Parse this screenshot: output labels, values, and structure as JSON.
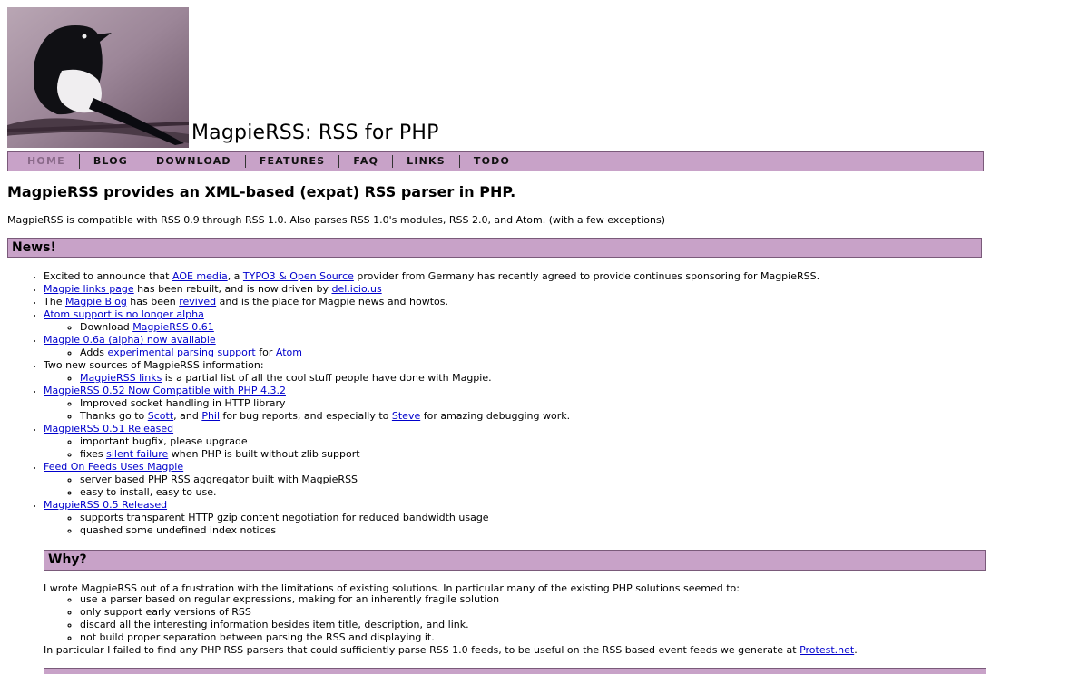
{
  "site": {
    "title": "MagpieRSS: RSS for PHP"
  },
  "nav": [
    {
      "label": "HOME"
    },
    {
      "label": "BLOG"
    },
    {
      "label": "DOWNLOAD"
    },
    {
      "label": "FEATURES"
    },
    {
      "label": "FAQ"
    },
    {
      "label": "LINKS"
    },
    {
      "label": "TODO"
    }
  ],
  "tagline": "MagpieRSS provides an XML-based (expat) RSS parser in PHP.",
  "intro": "MagpieRSS is compatible with RSS 0.9 through RSS 1.0. Also parses RSS 1.0's modules, RSS 2.0, and Atom. (with a few exceptions)",
  "news": {
    "heading": "News!",
    "items": {
      "i0": {
        "t1": "Excited to announce that ",
        "l1": "AOE media",
        "t2": ", a ",
        "l2": "TYPO3 & Open Source",
        "t3": " provider from Germany has recently agreed to provide continues sponsoring for MagpieRSS."
      },
      "i1": {
        "l1": "Magpie links page",
        "t1": " has been rebuilt, and is now driven by ",
        "l2": "del.icio.us"
      },
      "i2": {
        "t1": "The ",
        "l1": "Magpie Blog",
        "t2": " has been ",
        "l2": "revived",
        "t3": " and is the place for Magpie news and howtos."
      },
      "i3": {
        "l1": "Atom support is no longer alpha",
        "s1t": "Download ",
        "s1l": "MagpieRSS 0.61"
      },
      "i4": {
        "l1": "Magpie 0.6a (alpha) now available",
        "s1t": "Adds ",
        "s1l": "experimental parsing support",
        "s1t2": " for ",
        "s1l2": "Atom"
      },
      "i5": {
        "t1": "Two new sources of MagpieRSS information:",
        "s1l": "MagpieRSS links",
        "s1t": " is a partial list of all the cool stuff people have done with Magpie."
      },
      "i6": {
        "l1": "MagpieRSS 0.52 Now Compatible with PHP 4.3.2",
        "s1": "Improved socket handling in HTTP library",
        "s2t1": "Thanks go to ",
        "s2l1": "Scott",
        "s2t2": ", and ",
        "s2l2": "Phil",
        "s2t3": " for bug reports, and especially to ",
        "s2l3": "Steve",
        "s2t4": " for amazing debugging work."
      },
      "i7": {
        "l1": "MagpieRSS 0.51 Released",
        "s1": "important bugfix, please upgrade",
        "s2t1": "fixes ",
        "s2l1": "silent failure",
        "s2t2": " when PHP is built without zlib support"
      },
      "i8": {
        "l1": "Feed On Feeds Uses Magpie",
        "s1": "server based PHP RSS aggregator built with MagpieRSS",
        "s2": "easy to install, easy to use."
      },
      "i9": {
        "l1": "MagpieRSS 0.5 Released",
        "s1": "supports transparent HTTP gzip content negotiation for reduced bandwidth usage",
        "s2": "quashed some undefined index notices"
      }
    }
  },
  "why": {
    "heading": "Why?",
    "text1": "I wrote MagpieRSS out of a frustration with the limitations of existing solutions. In particular many of the existing PHP solutions seemed to:",
    "items": [
      "use a parser based on regular expressions, making for an inherently fragile solution",
      "only support early versions of RSS",
      "discard all the interesting information besides item title, description, and link.",
      "not build proper separation between parsing the RSS and displaying it."
    ],
    "text2a": "In particular I failed to find any PHP RSS parsers that could sufficiently parse RSS 1.0 feeds, to be useful on the RSS based event feeds we generate at ",
    "text2l": "Protest.net",
    "text2b": "."
  }
}
